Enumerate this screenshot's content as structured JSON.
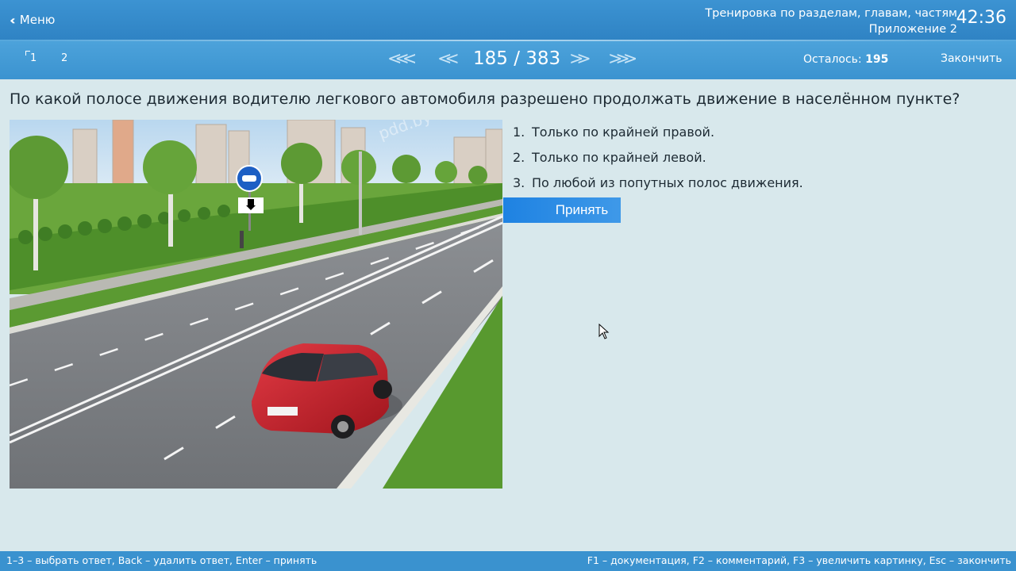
{
  "header": {
    "menu_label": "Меню",
    "mode_title": "Тренировка по разделам, главам, частям",
    "mode_subtitle": "Приложение 2",
    "timer": "42:36"
  },
  "nav": {
    "pages": [
      "1",
      "2"
    ],
    "counter": "185 / 383",
    "remaining_label": "Осталось:",
    "remaining_value": "195",
    "finish_label": "Закончить"
  },
  "question": {
    "text": "По какой полосе движения водителю легкового автомобиля разрешено продолжать движение в населённом пункте?",
    "answers": [
      {
        "num": "1.",
        "text": "Только по крайней правой."
      },
      {
        "num": "2.",
        "text": "Только по крайней левой."
      },
      {
        "num": "3.",
        "text": "По любой из попутных полос движения."
      }
    ],
    "accept_label": "Принять",
    "image_watermark": "pdd.by"
  },
  "status": {
    "hint_left": "1–3 – выбрать ответ, Back – удалить ответ, Enter – принять",
    "hint_right": "F1 – документация, F2 – комментарий, F3 – увеличить картинку, Esc – закончить"
  },
  "colors": {
    "header": "#3c93d2",
    "accent": "#1e82e2",
    "background": "#d8e8ec"
  }
}
